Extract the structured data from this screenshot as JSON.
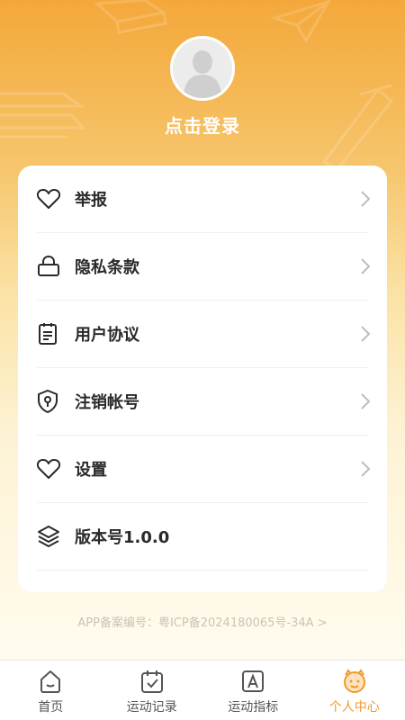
{
  "header": {
    "login_text": "点击登录"
  },
  "menu": {
    "items": [
      {
        "label": "举报",
        "icon": "heart-icon",
        "has_chevron": true
      },
      {
        "label": "隐私条款",
        "icon": "lock-icon",
        "has_chevron": true
      },
      {
        "label": "用户协议",
        "icon": "document-icon",
        "has_chevron": true
      },
      {
        "label": "注销帐号",
        "icon": "shield-icon",
        "has_chevron": true
      },
      {
        "label": "设置",
        "icon": "heart-icon",
        "has_chevron": true
      },
      {
        "label": "版本号1.0.0",
        "icon": "layers-icon",
        "has_chevron": false
      }
    ]
  },
  "footer": {
    "icp_text": "APP备案编号：粤ICP备2024180065号-34A >"
  },
  "tabbar": {
    "tabs": [
      {
        "label": "首页",
        "icon": "home-icon",
        "active": false
      },
      {
        "label": "运动记录",
        "icon": "calendar-check-icon",
        "active": false
      },
      {
        "label": "运动指标",
        "icon": "letter-a-icon",
        "active": false
      },
      {
        "label": "个人中心",
        "icon": "face-icon",
        "active": true
      }
    ]
  },
  "colors": {
    "accent": "#f09a2c",
    "header_top": "#f4a83a",
    "card_bg": "#ffffff",
    "text_primary": "#2a2a2a"
  }
}
